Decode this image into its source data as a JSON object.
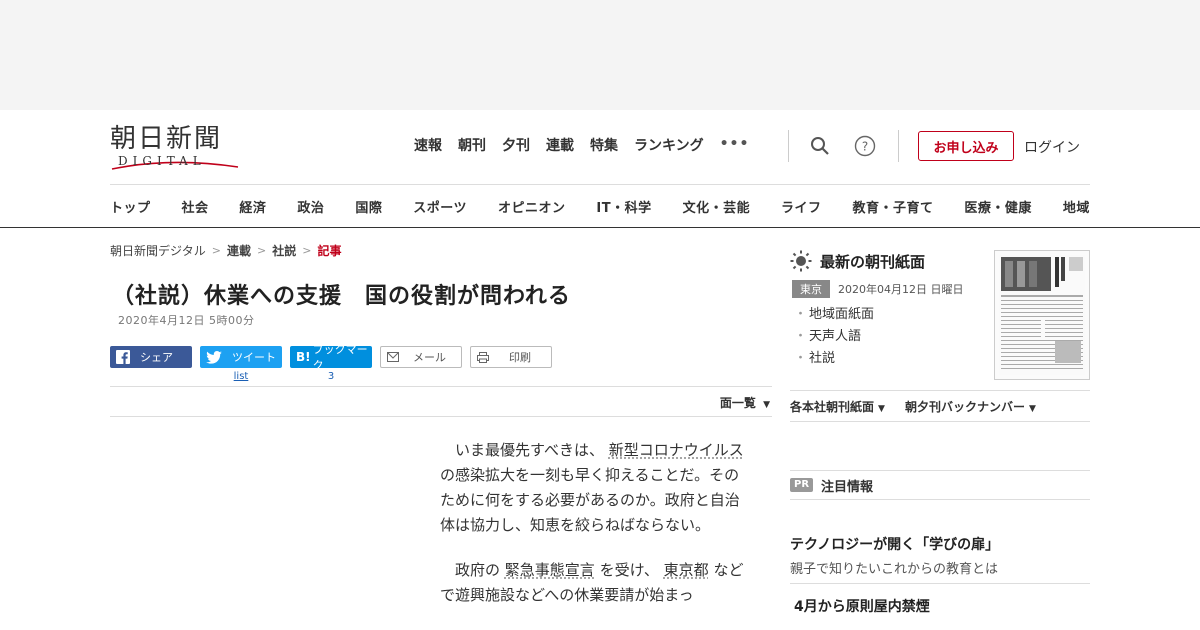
{
  "header": {
    "logo_jp": "朝日新聞",
    "logo_en": "DIGITAL",
    "nav": [
      "速報",
      "朝刊",
      "夕刊",
      "連載",
      "特集",
      "ランキング"
    ],
    "more": "•••",
    "apply_label": "お申し込み",
    "login_label": "ログイン"
  },
  "categories": [
    "トップ",
    "社会",
    "経済",
    "政治",
    "国際",
    "スポーツ",
    "オピニオン",
    "IT・科学",
    "文化・芸能",
    "ライフ",
    "教育・子育て",
    "医療・健康",
    "地域"
  ],
  "breadcrumb": [
    "朝日新聞デジタル",
    "連載",
    "社説",
    "記事"
  ],
  "article": {
    "title": "（社説）休業への支援　国の役割が問われる",
    "date": "2020年4月12日 5時00分",
    "body_p1_a": "いま最優先すべきは、",
    "body_p1_kw": "新型コロナウイルス",
    "body_p1_b": "の感染拡大を一刻も早く抑えることだ。そのために何をする必要があるのか。政府と自治体は協力し、知恵を絞らねばならない。",
    "body_p2_a": "政府の",
    "body_p2_kw1": "緊急事態宣言",
    "body_p2_b": "を受け、",
    "body_p2_kw2": "東京都",
    "body_p2_c": "などで遊興施設などへの休業要請が始まっ"
  },
  "share": {
    "facebook": "シェア",
    "twitter": "ツイート",
    "twitter_count": "list",
    "hatena": "ブックマーク",
    "hatena_count": "3",
    "mail": "メール",
    "print": "印刷"
  },
  "listing": {
    "label": "面一覧"
  },
  "sidebar": {
    "paper_title": "最新の朝刊紙面",
    "edition": "東京",
    "paper_date": "2020年04月12日 日曜日",
    "links": [
      "地域面紙面",
      "天声人語",
      "社説"
    ],
    "dropdown1": "各本社朝刊紙面",
    "dropdown2": "朝夕刊バックナンバー",
    "pr_badge": "PR",
    "pr_label": "注目情報",
    "promo1_title": "テクノロジーが開く「学びの扉」",
    "promo1_sub": "親子で知りたいこれからの教育とは",
    "promo2_title": "4月から原則屋内禁煙"
  },
  "colors": {
    "accent": "#c0001a",
    "facebook": "#3b5998",
    "twitter": "#1da1f2",
    "hatena": "#008fde"
  },
  "icons": {
    "search": "search-icon",
    "help": "help-icon",
    "sun": "sun-icon",
    "mail": "mail-icon",
    "print": "print-icon"
  }
}
